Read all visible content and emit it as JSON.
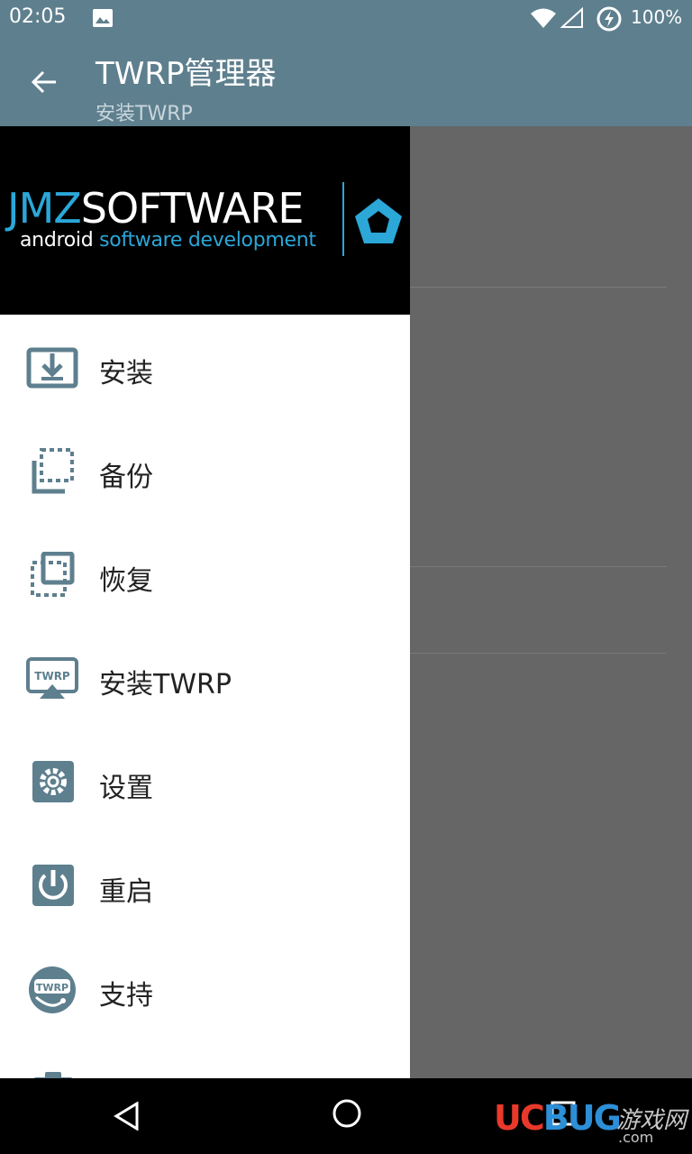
{
  "status_bar": {
    "time": "02:05",
    "battery_percent": "100%",
    "icons": [
      "image-icon",
      "wifi-icon",
      "signal-icon",
      "battery-charging-icon"
    ]
  },
  "app_bar": {
    "title": "TWRP管理器",
    "subtitle": "安装TWRP"
  },
  "drawer": {
    "header": {
      "brand_part1": "JMZ",
      "brand_part2": "SOFTWARE",
      "tagline_part1": "android",
      "tagline_part2": "software development"
    },
    "items": [
      {
        "label": "安装",
        "icon": "install-download-icon"
      },
      {
        "label": "备份",
        "icon": "backup-icon"
      },
      {
        "label": "恢复",
        "icon": "restore-icon"
      },
      {
        "label": "安装TWRP",
        "icon": "twrp-install-icon"
      },
      {
        "label": "设置",
        "icon": "settings-gear-icon"
      },
      {
        "label": "重启",
        "icon": "reboot-power-icon"
      },
      {
        "label": "支持",
        "icon": "support-headset-icon"
      }
    ]
  },
  "watermark": {
    "brand_uc": "UC",
    "brand_bug": "BUG",
    "right_text": "游戏网",
    "domain": ".com"
  },
  "colors": {
    "app_bar": "#5e7f8e",
    "accent": "#2ba7d8",
    "icon": "#5e7f8e",
    "scrim": "#666666"
  }
}
